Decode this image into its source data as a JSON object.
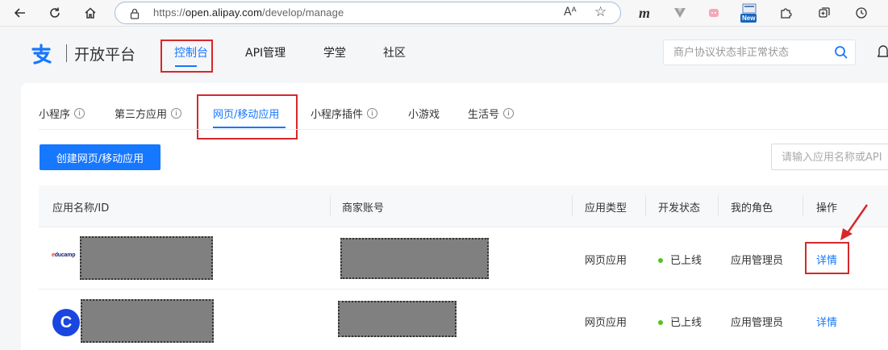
{
  "browser": {
    "url_prefix": "https://",
    "url_host": "open.alipay.com",
    "url_path": "/develop/manage",
    "reader_label": "Aᴬ",
    "ext_m_label": "m",
    "ext_new_badge": "New"
  },
  "header": {
    "brand": "开放平台",
    "nav": [
      {
        "label": "控制台",
        "active": true
      },
      {
        "label": "API管理"
      },
      {
        "label": "学堂"
      },
      {
        "label": "社区"
      }
    ],
    "search_placeholder": "商户协议状态非正常状态"
  },
  "subtabs": [
    {
      "label": "小程序",
      "info": true
    },
    {
      "label": "第三方应用",
      "info": true
    },
    {
      "label": "网页/移动应用",
      "active": true
    },
    {
      "label": "小程序插件",
      "info": true
    },
    {
      "label": "小游戏"
    },
    {
      "label": "生活号",
      "info": true
    }
  ],
  "actions": {
    "create_label": "创建网页/移动应用",
    "search_placeholder": "请输入应用名称或API"
  },
  "table": {
    "columns": [
      "应用名称/ID",
      "商家账号",
      "应用类型",
      "开发状态",
      "我的角色",
      "操作"
    ],
    "rows": [
      {
        "logo_text_prefix": "e",
        "logo_text": "ducamp",
        "type": "网页应用",
        "status": "已上线",
        "role": "应用管理员",
        "action": "详情"
      },
      {
        "logo_text": "C",
        "type": "网页应用",
        "status": "已上线",
        "role": "应用管理员",
        "action": "详情"
      }
    ]
  },
  "colors": {
    "accent": "#1677ff",
    "highlight": "#d6282a",
    "online": "#52c41a"
  }
}
